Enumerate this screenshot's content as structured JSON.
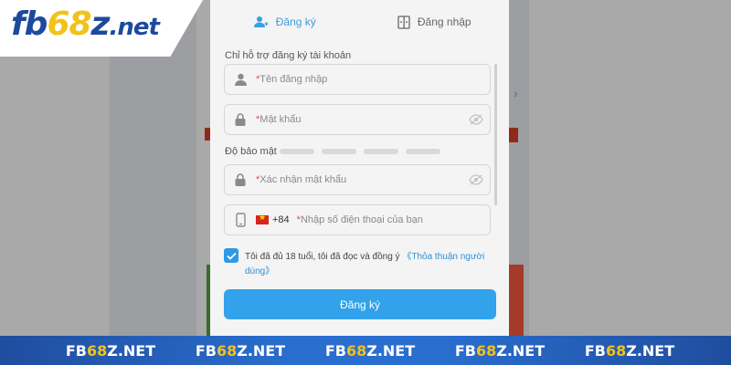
{
  "brand": {
    "logo_part1": "fb",
    "logo_part2": "68",
    "logo_part3": "z",
    "logo_domain": ".net",
    "colors": {
      "blue": "#1d4a9e",
      "yellow": "#f2c21b"
    }
  },
  "tabs": [
    {
      "label": "Đăng ký",
      "icon": "add-user-icon",
      "active": true
    },
    {
      "label": "Đăng nhập",
      "icon": "login-door-icon",
      "active": false
    }
  ],
  "form": {
    "section_label": "Chỉ hỗ trợ đăng ký tài khoản",
    "required_mark": "*",
    "username": {
      "placeholder": "Tên đăng nhập",
      "icon": "user-icon"
    },
    "password": {
      "placeholder": "Mật khẩu",
      "icon": "lock-icon",
      "toggle_icon": "eye-off-icon"
    },
    "strength": {
      "label": "Độ bảo mật",
      "level": 0,
      "segments": 4
    },
    "confirm_password": {
      "placeholder": "Xác nhận mật khẩu",
      "icon": "lock-icon",
      "toggle_icon": "eye-off-icon"
    },
    "phone": {
      "icon": "phone-icon",
      "flag": "vietnam-flag-icon",
      "country_code": "+84",
      "placeholder": "Nhập số điện thoại của bạn"
    },
    "terms": {
      "checked": true,
      "text": "Tôi đã đủ 18 tuổi, tôi đã đọc và đồng ý ",
      "link": "《Thỏa thuận người dùng》"
    },
    "submit_label": "Đăng ký",
    "accent_color": "#32a2ea"
  },
  "banner": {
    "items": [
      {
        "a": "FB",
        "b": "68",
        "c": "Z.NET"
      },
      {
        "a": "FB",
        "b": "68",
        "c": "Z.NET"
      },
      {
        "a": "FB",
        "b": "68",
        "c": "Z.NET"
      },
      {
        "a": "FB",
        "b": "68",
        "c": "Z.NET"
      },
      {
        "a": "FB",
        "b": "68",
        "c": "Z.NET"
      }
    ]
  }
}
